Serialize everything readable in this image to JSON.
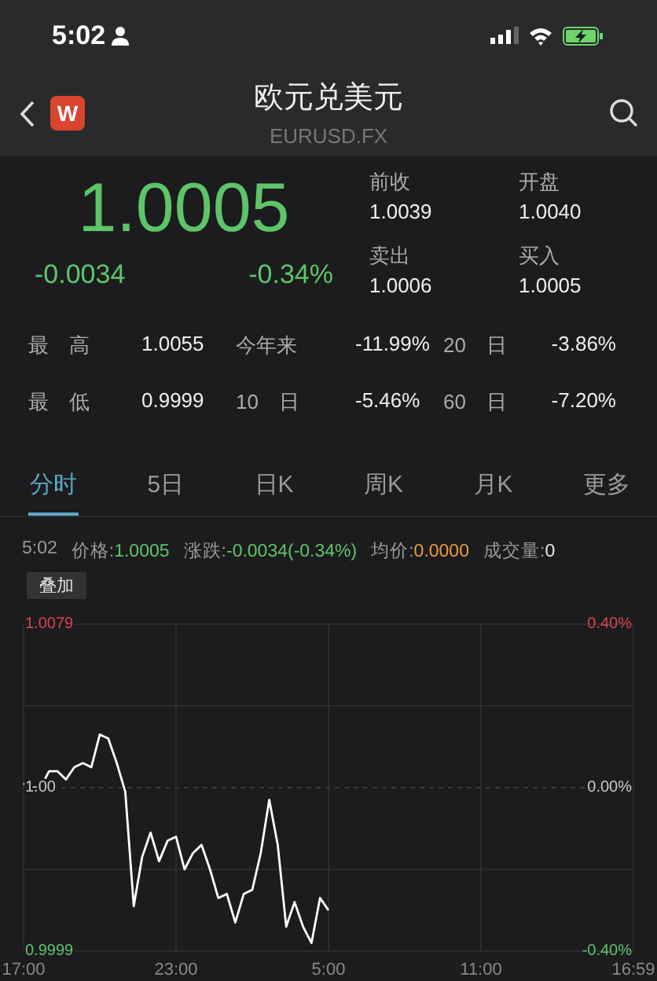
{
  "status_bar": {
    "time": "5:02"
  },
  "nav": {
    "title": "欧元兑美元",
    "subtitle": "EURUSD.FX",
    "logo_letter": "W"
  },
  "quote": {
    "price": "1.0005",
    "change": "-0.0034",
    "change_pct": "-0.34%",
    "fields": [
      {
        "label": "前收",
        "value": "1.0039"
      },
      {
        "label": "开盘",
        "value": "1.0040"
      },
      {
        "label": "卖出",
        "value": "1.0006"
      },
      {
        "label": "买入",
        "value": "1.0005"
      }
    ]
  },
  "stats": [
    [
      {
        "label": "最　高",
        "value": "1.0055"
      },
      {
        "label": "今年来",
        "value": "-11.99%"
      },
      {
        "label": "20　日",
        "value": "-3.86%"
      }
    ],
    [
      {
        "label": "最　低",
        "value": "0.9999"
      },
      {
        "label": "10　日",
        "value": "-5.46%"
      },
      {
        "label": "60　日",
        "value": "-7.20%"
      }
    ]
  ],
  "tabs": [
    {
      "label": "分时",
      "selected": true
    },
    {
      "label": "5日",
      "selected": false
    },
    {
      "label": "日K",
      "selected": false
    },
    {
      "label": "周K",
      "selected": false
    },
    {
      "label": "月K",
      "selected": false
    },
    {
      "label": "更多",
      "selected": false
    }
  ],
  "info_line": {
    "time": "5:02",
    "items": [
      {
        "label": "价格:",
        "value": "1.0005",
        "color": "#5ec46a"
      },
      {
        "label": "涨跌:",
        "value": "-0.0034(-0.34%)",
        "color": "#5ec46a"
      },
      {
        "label": "均价:",
        "value": "0.0000",
        "color": "#e89b3a"
      },
      {
        "label": "成交量:",
        "value": "0",
        "color": "#e6e6e6"
      }
    ]
  },
  "overlay_button": "叠加",
  "chart": {
    "percent_labels": [
      {
        "label": "0.40%",
        "color": "#d9454a"
      },
      {
        "label": "0.00%",
        "color": "#c8c8c8"
      },
      {
        "label": "-0.40%",
        "color": "#5ec46a"
      }
    ],
    "chart_data": {
      "type": "line",
      "grid": true,
      "ylim": [
        0.9999,
        1.0079
      ],
      "ref_lines": [
        {
          "axis": "y",
          "value": 1.0039
        }
      ],
      "categories": [
        "17:00",
        null,
        null,
        null,
        null,
        null,
        null,
        null,
        null,
        null,
        null,
        null,
        null,
        null,
        null,
        null,
        null,
        null,
        "23:00",
        null,
        null,
        null,
        null,
        null,
        null,
        null,
        null,
        null,
        null,
        null,
        null,
        null,
        null,
        null,
        null,
        null,
        "5:00",
        null,
        null,
        null,
        null,
        null,
        null,
        null,
        null,
        null,
        null,
        null,
        null,
        null,
        null,
        null,
        null,
        null,
        "11:00",
        null,
        null,
        null,
        null,
        null,
        null,
        null,
        null,
        null,
        null,
        null,
        null,
        null,
        null,
        null,
        null,
        null,
        "16:59"
      ],
      "yticks": [
        {
          "value": 1.0079,
          "label": "1.0079"
        },
        {
          "value": 1.0039,
          "label": "1.00"
        },
        {
          "value": 0.9999,
          "label": "0.9999"
        }
      ],
      "series": [
        {
          "color": "#ffffff",
          "values": [
            1.004,
            1.0039,
            1.0039,
            1.0043,
            1.0043,
            1.0041,
            1.0044,
            1.0045,
            1.0044,
            1.0052,
            1.0051,
            1.0045,
            1.0038,
            1.001,
            1.0022,
            1.0028,
            1.0021,
            1.0026,
            1.0027,
            1.0019,
            1.0023,
            1.0025,
            1.0019,
            1.0012,
            1.0013,
            1.0006,
            1.0013,
            1.0014,
            1.0023,
            1.0036,
            1.0025,
            1.0005,
            1.0011,
            1.0005,
            1.0001,
            1.0012,
            1.0009,
            null,
            null,
            null,
            null,
            null,
            null,
            null,
            null,
            null,
            null,
            null,
            null,
            null,
            null,
            null,
            null,
            null,
            null,
            null,
            null,
            null,
            null,
            null,
            null,
            null,
            null,
            null,
            null,
            null,
            null,
            null,
            null,
            null,
            null,
            null,
            null
          ]
        }
      ]
    }
  }
}
